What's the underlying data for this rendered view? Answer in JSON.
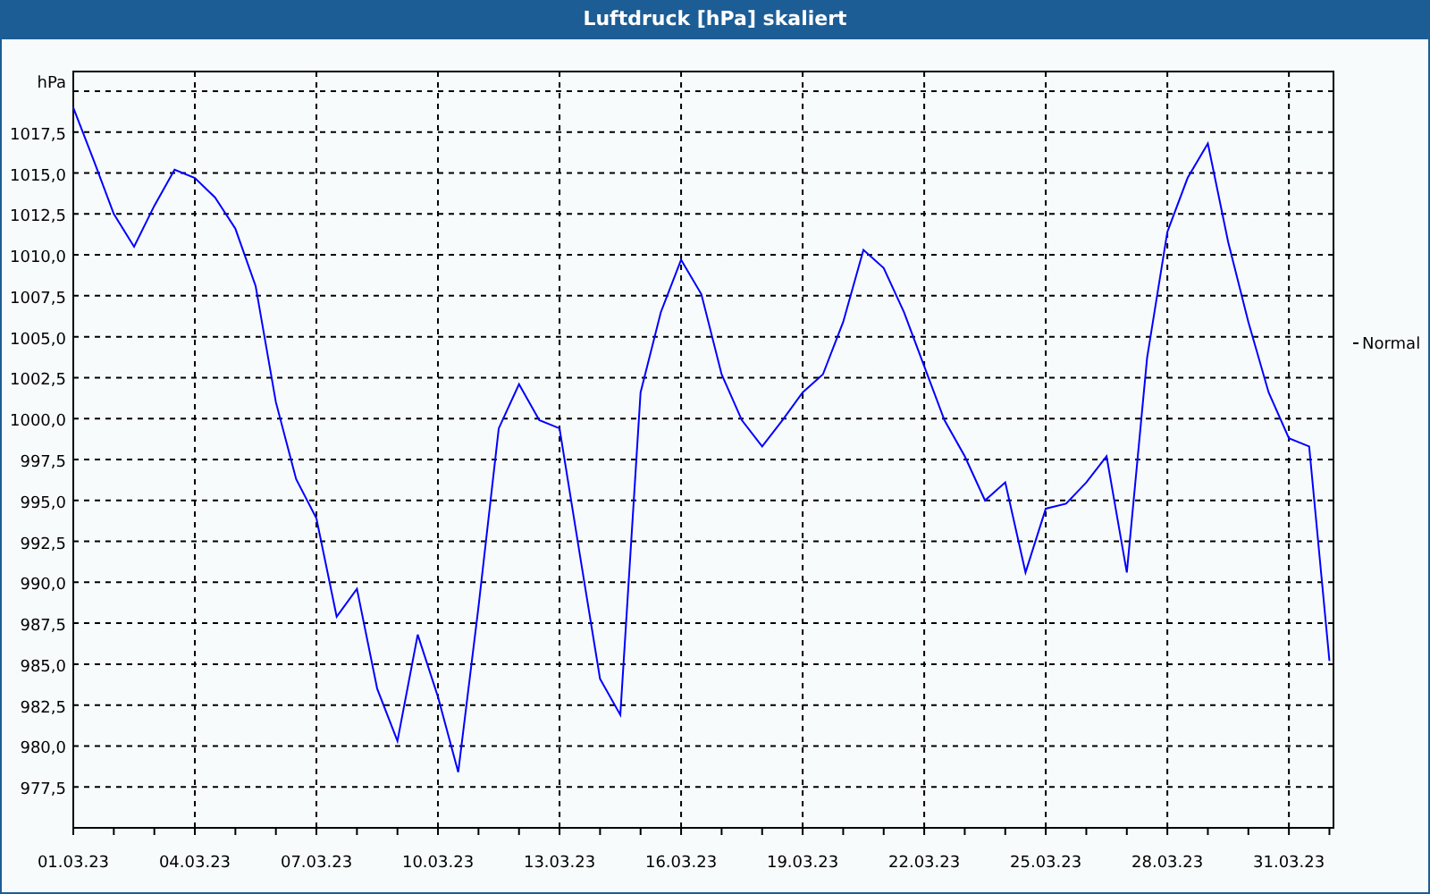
{
  "window": {
    "title": "Luftdruck [hPa] skaliert"
  },
  "chart": {
    "unit_label": "hPa",
    "chart_data": {
      "type": "line",
      "grid": true,
      "ylim": [
        975,
        1021.2
      ],
      "categories": [
        "01.03.23",
        null,
        null,
        null,
        null,
        null,
        "04.03.23",
        null,
        null,
        null,
        null,
        null,
        "07.03.23",
        null,
        null,
        null,
        null,
        null,
        "10.03.23",
        null,
        null,
        null,
        null,
        null,
        "13.03.23",
        null,
        null,
        null,
        null,
        null,
        "16.03.23",
        null,
        null,
        null,
        null,
        null,
        "19.03.23",
        null,
        null,
        null,
        null,
        null,
        "22.03.23",
        null,
        null,
        null,
        null,
        null,
        "25.03.23",
        null,
        null,
        null,
        null,
        null,
        "28.03.23",
        null,
        null,
        null,
        null,
        null,
        "31.03.23",
        null,
        null
      ],
      "series": [
        {
          "color": "#0000ff",
          "values": [
            1019.0,
            1015.8,
            1012.5,
            1010.5,
            1013.0,
            1015.2,
            1014.7,
            1013.5,
            1011.6,
            1008.1,
            1001.0,
            996.3,
            993.9,
            987.9,
            989.6,
            983.5,
            980.3,
            986.8,
            983.0,
            978.4,
            988.5,
            999.4,
            1002.1,
            999.9,
            999.4,
            991.7,
            984.1,
            981.9,
            1001.6,
            1006.5,
            1009.7,
            1007.6,
            1002.7,
            999.9,
            998.3,
            999.9,
            1001.6,
            1002.7,
            1005.9,
            1010.3,
            1009.2,
            1006.5,
            1003.2,
            999.9,
            997.7,
            995.0,
            996.1,
            990.6,
            994.5,
            994.8,
            996.1,
            997.7,
            990.6,
            1003.7,
            1011.4,
            1014.7,
            1016.8,
            1010.8,
            1005.9,
            1001.6,
            998.8,
            998.3,
            985.2
          ]
        }
      ],
      "yticks": [
        {
          "value": 977.5,
          "label": "977,5"
        },
        {
          "value": 980,
          "label": "980,0"
        },
        {
          "value": 982.5,
          "label": "982,5"
        },
        {
          "value": 985,
          "label": "985,0"
        },
        {
          "value": 987.5,
          "label": "987,5"
        },
        {
          "value": 990,
          "label": "990,0"
        },
        {
          "value": 992.5,
          "label": "992,5"
        },
        {
          "value": 995,
          "label": "995,0"
        },
        {
          "value": 997.5,
          "label": "997,5"
        },
        {
          "value": 1000,
          "label": "1000,0"
        },
        {
          "value": 1002.5,
          "label": "1002,5"
        },
        {
          "value": 1005,
          "label": "1005,0"
        },
        {
          "value": 1007.5,
          "label": "1007,5"
        },
        {
          "value": 1010,
          "label": "1010,0"
        },
        {
          "value": 1012.5,
          "label": "1012,5"
        },
        {
          "value": 1015,
          "label": "1015,0"
        },
        {
          "value": 1017.5,
          "label": "1017,5"
        }
      ],
      "annotations": [
        "Normal"
      ]
    }
  }
}
